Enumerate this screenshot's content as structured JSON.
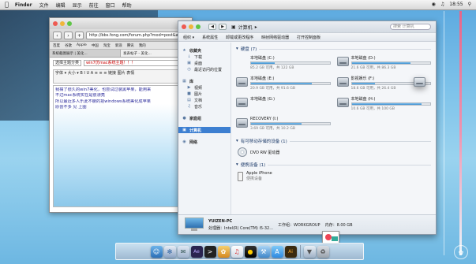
{
  "menubar": {
    "app_name": "Finder",
    "items": [
      "文件",
      "编辑",
      "显示",
      "前往",
      "窗口",
      "帮助"
    ],
    "clock": "18:55"
  },
  "browser": {
    "address": "http://bbs.fong.com/forum.php?mod=post&action=",
    "bookmarks": [
      "百度",
      "谷歌",
      "Apple",
      "中国",
      "淘宝",
      "新浪",
      "腾讯",
      "我的"
    ],
    "tabs": [
      "系统截图展示 | 美化...",
      "发表帖子 - 美化..."
    ],
    "form": {
      "category_label": "选择主题分类",
      "subject": "win7仿mac系统主题！！！"
    },
    "editor_toolbar": "字体 ▾  大小 ▾  B  I  U  A  ≡  ≡  ≡  链接  图片  表情",
    "body_lines": [
      "我搞了很久的win7美化，也尝试过装黑苹果，能用来",
      "不过mac系统实在是很漂亮",
      "所以最近多人乐此不疲的把windows系统美化成苹果",
      "原创不多 见 上图"
    ]
  },
  "explorer": {
    "path": [
      "计算机"
    ],
    "search_placeholder": "搜索 计算机",
    "commands": [
      "组织 ▾",
      "系统属性",
      "卸载或更改程序",
      "映射网络驱动器",
      "打开控制面板"
    ],
    "sidebar": {
      "favorites": {
        "label": "收藏夹",
        "items": [
          "下载",
          "桌面",
          "最近访问的位置"
        ]
      },
      "libraries": {
        "label": "库",
        "items": [
          "视频",
          "图片",
          "文档",
          "音乐"
        ]
      },
      "homegroup": "家庭组",
      "computer": "计算机",
      "network": "网络"
    },
    "sections": {
      "hard_disks": "硬盘 (7)",
      "removable": "有可移动存储的设备 (1)",
      "portable": "便携设备 (1)"
    },
    "drives": [
      {
        "name": "本地磁盘 (C:)",
        "free": "85.2 GB 可用，共 122 GB",
        "used_pct": 30
      },
      {
        "name": "本地磁盘 (D:)",
        "free": "21.6 GB 可用，共 86.3 GB",
        "used_pct": 75
      },
      {
        "name": "本地磁盘 (E:)",
        "free": "20.9 GB 可用，共 91.6 GB",
        "used_pct": 77
      },
      {
        "name": "影视娱乐 (F:)",
        "free": "18.6 GB 可用，共 26.4 GB",
        "used_pct": 30
      },
      {
        "name": "本地磁盘 (G:)",
        "free": "",
        "used_pct": 0
      },
      {
        "name": "本地磁盘 (H:)",
        "free": "10.6 GB 可用，共 100 GB",
        "used_pct": 89
      },
      {
        "name": "RECOVERY (I:)",
        "free": "3.69 GB 可用，共 10.2 GB",
        "used_pct": 64
      }
    ],
    "dvd": "DVD RW 驱动器",
    "device": {
      "name": "Apple iPhone",
      "sub": "便携设备"
    },
    "status": {
      "pc_name": "YUIZEN-PC",
      "workgroup": "工作组：WORKGROUP",
      "memory": "内存：8.00 GB",
      "processor": "处理器：Intel(R) Core(TM) i5-32..."
    }
  },
  "dock": [
    "Finder",
    "Safari",
    "Mail",
    "AE",
    "Terminal",
    "Photo",
    "iTunes",
    "QQ",
    "Xcode",
    "App Store",
    "AI",
    "Trash"
  ]
}
